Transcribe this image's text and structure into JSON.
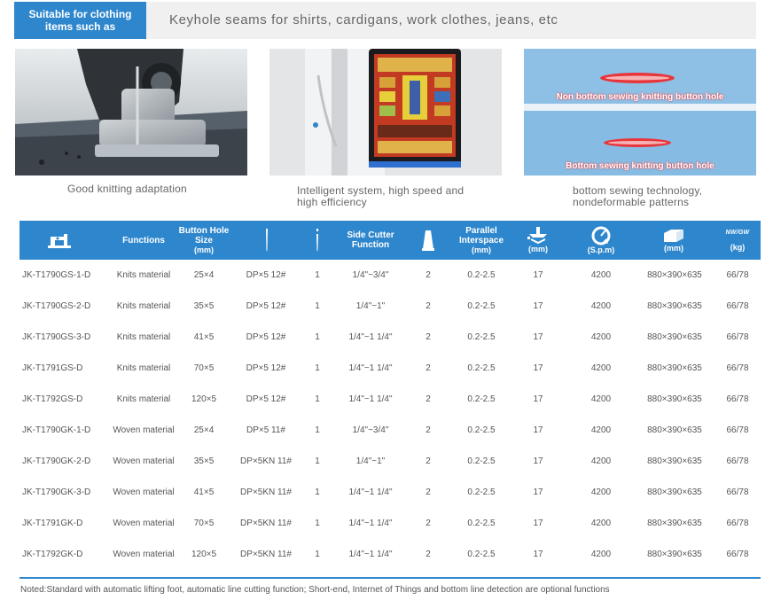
{
  "banner": {
    "tag": "Suitable for clothing\nitems such as",
    "text": "Keyhole seams for shirts, cardigans, work clothes, jeans, etc"
  },
  "features": [
    {
      "caption": "Good knitting adaptation"
    },
    {
      "caption": "Intelligent system, high speed and\nhigh efficiency"
    },
    {
      "caption": "bottom sewing technology,\nnondeformable patterns",
      "label_top": "Non bottom sewing knitting button hole",
      "label_bottom": "Bottom sewing knitting button hole"
    }
  ],
  "table": {
    "headers": [
      {
        "icon": "sewing-machine-icon",
        "text": "",
        "unit": ""
      },
      {
        "text": "Functions",
        "unit": ""
      },
      {
        "text": "Button Hole\nSize",
        "unit": "(mm)"
      },
      {
        "icon": "needle-icon",
        "text": "",
        "unit": ""
      },
      {
        "icon": "needle-count-icon",
        "text": "",
        "unit": ""
      },
      {
        "text": "Side Cutter\nFunction",
        "unit": ""
      },
      {
        "icon": "bobbin-icon",
        "text": "",
        "unit": ""
      },
      {
        "text": "Parallel\nInterspace",
        "unit": "(mm)"
      },
      {
        "icon": "presser-foot-icon",
        "text": "",
        "unit": "(mm)"
      },
      {
        "icon": "speed-icon",
        "text": "",
        "unit": "(S.p.m)"
      },
      {
        "icon": "box-icon",
        "text": "",
        "unit": "(mm)"
      },
      {
        "icon": "weight-icon",
        "text": "NW/GW",
        "unit": "(kg)"
      }
    ],
    "rows": [
      [
        "JK-T1790GS-1-D",
        "Knits material",
        "25×4",
        "DP×5  12#",
        "1",
        "1/4\"~3/4\"",
        "2",
        "0.2-2.5",
        "17",
        "4200",
        "880×390×635",
        "66/78"
      ],
      [
        "JK-T1790GS-2-D",
        "Knits material",
        "35×5",
        "DP×5  12#",
        "1",
        "1/4\"~1\"",
        "2",
        "0.2-2.5",
        "17",
        "4200",
        "880×390×635",
        "66/78"
      ],
      [
        "JK-T1790GS-3-D",
        "Knits material",
        "41×5",
        "DP×5  12#",
        "1",
        "1/4\"~1 1/4\"",
        "2",
        "0.2-2.5",
        "17",
        "4200",
        "880×390×635",
        "66/78"
      ],
      [
        "JK-T1791GS-D",
        "Knits material",
        "70×5",
        "DP×5  12#",
        "1",
        "1/4\"~1 1/4\"",
        "2",
        "0.2-2.5",
        "17",
        "4200",
        "880×390×635",
        "66/78"
      ],
      [
        "JK-T1792GS-D",
        "Knits material",
        "120×5",
        "DP×5  12#",
        "1",
        "1/4\"~1 1/4\"",
        "2",
        "0.2-2.5",
        "17",
        "4200",
        "880×390×635",
        "66/78"
      ],
      [
        "JK-T1790GK-1-D",
        "Woven material",
        "25×4",
        "DP×5  11#",
        "1",
        "1/4\"~3/4\"",
        "2",
        "0.2-2.5",
        "17",
        "4200",
        "880×390×635",
        "66/78"
      ],
      [
        "JK-T1790GK-2-D",
        "Woven material",
        "35×5",
        "DP×5KN  11#",
        "1",
        "1/4\"~1\"",
        "2",
        "0.2-2.5",
        "17",
        "4200",
        "880×390×635",
        "66/78"
      ],
      [
        "JK-T1790GK-3-D",
        "Woven material",
        "41×5",
        "DP×5KN  11#",
        "1",
        "1/4\"~1 1/4\"",
        "2",
        "0.2-2.5",
        "17",
        "4200",
        "880×390×635",
        "66/78"
      ],
      [
        "JK-T1791GK-D",
        "Woven material",
        "70×5",
        "DP×5KN  11#",
        "1",
        "1/4\"~1 1/4\"",
        "2",
        "0.2-2.5",
        "17",
        "4200",
        "880×390×635",
        "66/78"
      ],
      [
        "JK-T1792GK-D",
        "Woven material",
        "120×5",
        "DP×5KN  11#",
        "1",
        "1/4\"~1 1/4\"",
        "2",
        "0.2-2.5",
        "17",
        "4200",
        "880×390×635",
        "66/78"
      ]
    ]
  },
  "note": "Noted:Standard with automatic lifting foot, automatic line cutting function; Short-end, Internet of Things and bottom line detection are optional functions",
  "colors": {
    "accent": "#2e87cd",
    "banner_bg": "#f0f0f0",
    "text": "#555555"
  }
}
